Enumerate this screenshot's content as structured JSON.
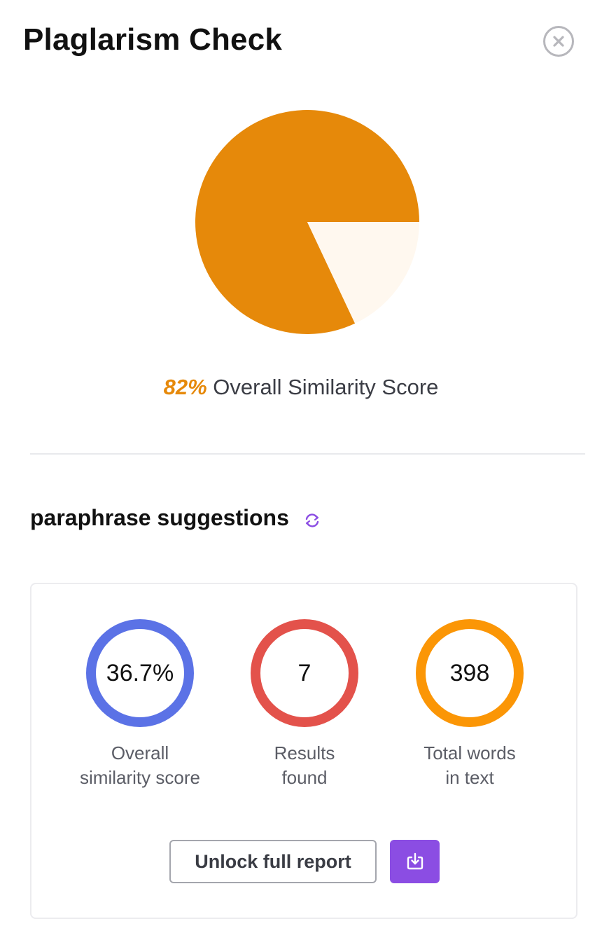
{
  "header": {
    "title": "Plaglarism Check",
    "close_icon": "close-circle-icon"
  },
  "chart_data": {
    "type": "pie",
    "values": [
      82,
      18
    ],
    "colors": [
      "#e6890a",
      "#fff8ef"
    ],
    "title": ""
  },
  "summary": {
    "percent": "82%",
    "label": "Overall Similarity Score",
    "accent_color": "#e6890a"
  },
  "suggestions": {
    "heading": "paraphrase suggestions",
    "refresh_icon": "refresh-icon",
    "stats": [
      {
        "value": "36.7%",
        "label": "Overall\nsimilarity score",
        "color": "#5b72e6"
      },
      {
        "value": "7",
        "label": "Results\nfound",
        "color": "#e3524b"
      },
      {
        "value": "398",
        "label": "Total words\nin text",
        "color": "#fb9606"
      }
    ],
    "unlock_label": "Unlock full report",
    "download_icon": "download-icon",
    "download_color": "#8b4de3"
  }
}
